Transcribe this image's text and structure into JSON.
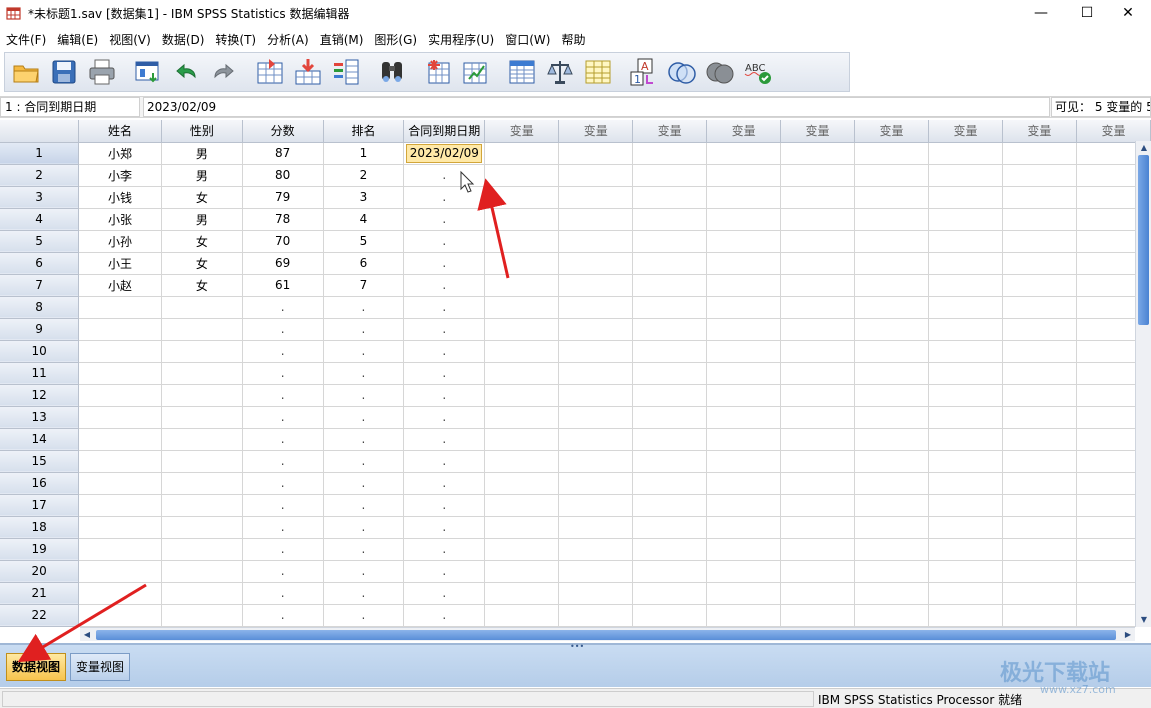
{
  "window": {
    "title": "*未标题1.sav [数据集1] - IBM SPSS Statistics 数据编辑器",
    "minimize": "—",
    "maximize": "☐",
    "close": "✕"
  },
  "menu": [
    "文件(F)",
    "编辑(E)",
    "视图(V)",
    "数据(D)",
    "转换(T)",
    "分析(A)",
    "直销(M)",
    "图形(G)",
    "实用程序(U)",
    "窗口(W)",
    "帮助"
  ],
  "toolbar": {
    "icons": [
      "open-folder-icon",
      "save-icon",
      "print-icon",
      "recall-dialog-icon",
      "undo-icon",
      "redo-icon",
      "goto-case-icon",
      "goto-variable-icon",
      "variables-icon",
      "find-icon",
      "insert-cases-icon",
      "insert-variable-icon",
      "split-file-icon",
      "weight-cases-icon",
      "select-cases-icon",
      "value-labels-icon",
      "use-sets-icon",
      "show-all-variables-icon",
      "spell-check-icon"
    ]
  },
  "cellbar": {
    "cell_ref": "1 : 合同到期日期",
    "cell_value": "2023/02/09",
    "visible_info": "可见： 5 变量的 5"
  },
  "grid": {
    "headers": [
      "姓名",
      "性别",
      "分数",
      "排名",
      "合同到期日期",
      "变量",
      "变量",
      "变量",
      "变量",
      "变量",
      "变量",
      "变量",
      "变量",
      "变量"
    ],
    "rows": [
      {
        "n": "1",
        "cells": [
          "小郑",
          "男",
          "87",
          "1",
          "2023/02/09"
        ]
      },
      {
        "n": "2",
        "cells": [
          "小李",
          "男",
          "80",
          "2",
          "."
        ]
      },
      {
        "n": "3",
        "cells": [
          "小钱",
          "女",
          "79",
          "3",
          "."
        ]
      },
      {
        "n": "4",
        "cells": [
          "小张",
          "男",
          "78",
          "4",
          "."
        ]
      },
      {
        "n": "5",
        "cells": [
          "小孙",
          "女",
          "70",
          "5",
          "."
        ]
      },
      {
        "n": "6",
        "cells": [
          "小王",
          "女",
          "69",
          "6",
          "."
        ]
      },
      {
        "n": "7",
        "cells": [
          "小赵",
          "女",
          "61",
          "7",
          "."
        ]
      },
      {
        "n": "8",
        "cells": [
          "",
          "",
          ".",
          ".",
          "."
        ]
      },
      {
        "n": "9",
        "cells": [
          "",
          "",
          ".",
          ".",
          "."
        ]
      },
      {
        "n": "10",
        "cells": [
          "",
          "",
          ".",
          ".",
          "."
        ]
      },
      {
        "n": "11",
        "cells": [
          "",
          "",
          ".",
          ".",
          "."
        ]
      },
      {
        "n": "12",
        "cells": [
          "",
          "",
          ".",
          ".",
          "."
        ]
      },
      {
        "n": "13",
        "cells": [
          "",
          "",
          ".",
          ".",
          "."
        ]
      },
      {
        "n": "14",
        "cells": [
          "",
          "",
          ".",
          ".",
          "."
        ]
      },
      {
        "n": "15",
        "cells": [
          "",
          "",
          ".",
          ".",
          "."
        ]
      },
      {
        "n": "16",
        "cells": [
          "",
          "",
          ".",
          ".",
          "."
        ]
      },
      {
        "n": "17",
        "cells": [
          "",
          "",
          ".",
          ".",
          "."
        ]
      },
      {
        "n": "18",
        "cells": [
          "",
          "",
          ".",
          ".",
          "."
        ]
      },
      {
        "n": "19",
        "cells": [
          "",
          "",
          ".",
          ".",
          "."
        ]
      },
      {
        "n": "20",
        "cells": [
          "",
          "",
          ".",
          ".",
          "."
        ]
      },
      {
        "n": "21",
        "cells": [
          "",
          "",
          ".",
          ".",
          "."
        ]
      },
      {
        "n": "22",
        "cells": [
          "",
          "",
          ".",
          ".",
          "."
        ]
      }
    ]
  },
  "tabs": {
    "data_view": "数据视图",
    "variable_view": "变量视图"
  },
  "status": {
    "processor": "IBM SPSS Statistics Processor 就绪"
  },
  "watermark": {
    "text": "极光下载站",
    "url": "www.xz7.com"
  },
  "colors": {
    "active_cell": "#ffe9a8",
    "active_tab": "#f7c44e",
    "annotation_arrow": "#e02020"
  }
}
